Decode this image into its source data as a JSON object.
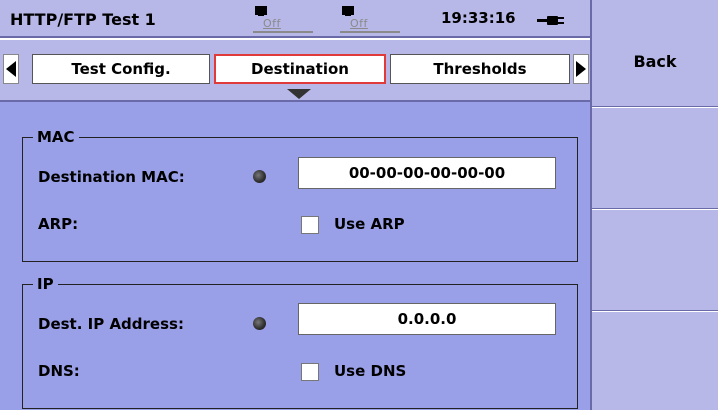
{
  "status_bar": {
    "title": "HTTP/FTP Test 1",
    "ports": [
      {
        "state": "Off"
      },
      {
        "state": "Off"
      }
    ],
    "clock": "19:33:16"
  },
  "tabs": [
    {
      "label": "Test Config.",
      "selected": false
    },
    {
      "label": "Destination",
      "selected": true
    },
    {
      "label": "Thresholds",
      "selected": false
    }
  ],
  "groups": {
    "mac": {
      "legend": "MAC",
      "dest_mac_label": "Destination MAC:",
      "dest_mac_value": "00-00-00-00-00-00",
      "arp_label": "ARP:",
      "arp_checkbox_label": "Use ARP",
      "arp_checked": false
    },
    "ip": {
      "legend": "IP",
      "dest_ip_label": "Dest. IP Address:",
      "dest_ip_value": "0.0.0.0",
      "dns_label": "DNS:",
      "dns_checkbox_label": "Use DNS",
      "dns_checked": false
    }
  },
  "soft_keys": [
    {
      "label": "Back"
    },
    {
      "label": ""
    },
    {
      "label": ""
    },
    {
      "label": ""
    }
  ],
  "colors": {
    "panel_bg": "#b8b8e8",
    "content_bg": "#9aa0e8",
    "selected_tab_border": "#e03a3a",
    "port_off": "#8a8a8a"
  }
}
